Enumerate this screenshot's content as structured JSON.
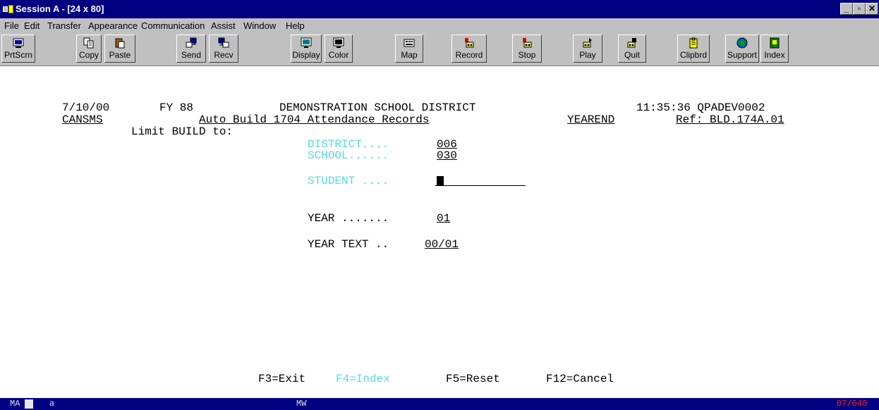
{
  "window": {
    "title": "Session A - [24 x 80]",
    "controls": [
      "_",
      "▫",
      "✕"
    ]
  },
  "menu": [
    "File",
    "Edit",
    "Transfer",
    "Appearance",
    "Communication",
    "Assist",
    "Window",
    "Help"
  ],
  "toolbar": [
    {
      "label": "PrtScrn",
      "icon": "print-screen-icon"
    },
    {
      "label": "Copy",
      "icon": "copy-icon"
    },
    {
      "label": "Paste",
      "icon": "paste-icon"
    },
    {
      "label": "Send",
      "icon": "send-icon"
    },
    {
      "label": "Recv",
      "icon": "receive-icon"
    },
    {
      "label": "Display",
      "icon": "display-icon"
    },
    {
      "label": "Color",
      "icon": "color-icon"
    },
    {
      "label": "Map",
      "icon": "map-icon"
    },
    {
      "label": "Record",
      "icon": "record-icon"
    },
    {
      "label": "Stop",
      "icon": "stop-icon"
    },
    {
      "label": "Play",
      "icon": "play-icon"
    },
    {
      "label": "Quit",
      "icon": "quit-icon"
    },
    {
      "label": "Clipbrd",
      "icon": "clipboard-icon"
    },
    {
      "label": "Support",
      "icon": "support-icon"
    },
    {
      "label": "Index",
      "icon": "index-icon"
    }
  ],
  "screen": {
    "date": "7/10/00",
    "fy": "FY 88",
    "district_name": "DEMONSTRATION SCHOOL DISTRICT",
    "time_program": "11:35:36 QPADEV0002",
    "system": "CANSMS",
    "screen_title": "Auto Build 1704 Attendance Records",
    "mode": "YEAREND",
    "ref": "Ref: BLD.174A.01",
    "limit_label": "Limit BUILD to:",
    "district_label": "DISTRICT....",
    "district_value": "006",
    "school_label": "SCHOOL......",
    "school_value": "030",
    "student_label": "STUDENT ....",
    "student_value": "",
    "year_label": "YEAR .......",
    "year_value": "01",
    "year_text_label": "YEAR TEXT ..",
    "year_text_value": "00/01",
    "fkeys": {
      "f3": "F3=Exit",
      "f4": "F4=Index",
      "f5": "F5=Reset",
      "f12": "F12=Cancel"
    }
  },
  "statusbar": {
    "mode": "MA",
    "session": "a",
    "indicator": "MW",
    "cursor_pos": "07/040"
  },
  "colors": {
    "title_bg": "#000080",
    "chrome": "#c0c0c0",
    "field_label_cyan": "#55dddd",
    "status_red": "#ff2020"
  }
}
